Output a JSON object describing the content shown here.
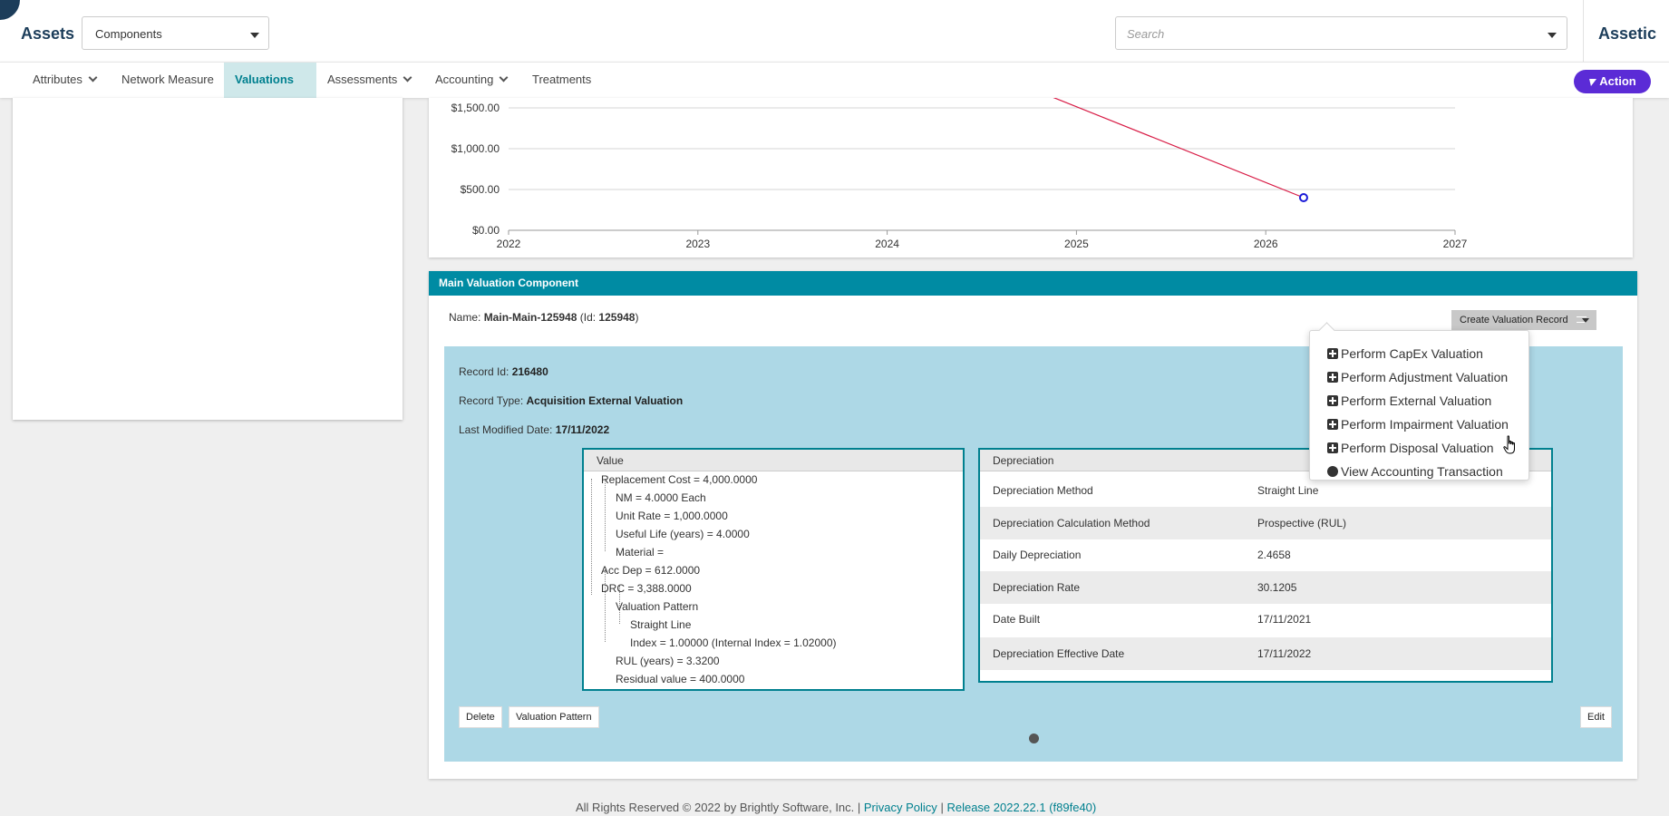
{
  "app": {
    "title": "Assets",
    "brand": "Assetic"
  },
  "module_select": {
    "value": "Components"
  },
  "search": {
    "placeholder": "Search"
  },
  "nav": {
    "items": [
      {
        "label": "Attributes"
      },
      {
        "label": "Network Measure"
      },
      {
        "label": "Valuations"
      },
      {
        "label": "Assessments"
      },
      {
        "label": "Accounting"
      },
      {
        "label": "Treatments"
      }
    ],
    "action_label": "Action"
  },
  "chart_data": {
    "type": "line",
    "x_ticks": [
      "2022",
      "2023",
      "2024",
      "2025",
      "2026",
      "2027"
    ],
    "y_ticks": [
      "$0.00",
      "$500.00",
      "$1,000.00",
      "$1,500.00"
    ],
    "ylim": [
      0,
      1650
    ],
    "xlim": [
      2022,
      2027
    ],
    "series": [
      {
        "x": [
          2024.8,
          2026.2
        ],
        "y": [
          1700,
          400
        ],
        "color": "#d81b45"
      }
    ],
    "highlight_point": {
      "x": 2026.2,
      "y": 400,
      "color": "#1a1ad8"
    }
  },
  "valuation": {
    "header": "Main Valuation Component",
    "name_label": "Name:",
    "name_value": "Main-Main-125948",
    "id_open": "(Id:",
    "id_value": "125948",
    "id_close": ")",
    "create_btn": "Create Valuation Record",
    "record_id_label": "Record Id:",
    "record_id": "216480",
    "record_type_label": "Record Type:",
    "record_type": "Acquisition External Valuation",
    "last_modified_label": "Last Modified Date:",
    "last_modified": "17/11/2022",
    "value_box_title": "Value",
    "tree": [
      "Replacement Cost = 4,000.0000",
      "NM = 4.0000 Each",
      "Unit Rate = 1,000.0000",
      "Useful Life (years) = 4.0000",
      "Material =",
      "Acc Dep = 612.0000",
      "DRC = 3,388.0000",
      "Valuation Pattern",
      "Straight Line",
      "Index = 1.00000 (Internal Index = 1.02000)",
      "RUL (years) = 3.3200",
      "Residual value = 400.0000"
    ],
    "dep_box_title": "Depreciation",
    "depreciation": [
      {
        "k": "Depreciation Method",
        "v": "Straight Line"
      },
      {
        "k": "Depreciation Calculation Method",
        "v": "Prospective (RUL)"
      },
      {
        "k": "Daily Depreciation",
        "v": "2.4658"
      },
      {
        "k": "Depreciation Rate",
        "v": "30.1205"
      },
      {
        "k": "Date Built",
        "v": "17/11/2021"
      },
      {
        "k": "Depreciation Effective Date",
        "v": "17/11/2022"
      }
    ],
    "delete_btn": "Delete",
    "pattern_btn": "Valuation Pattern",
    "edit_btn": "Edit"
  },
  "menu": {
    "items": [
      "Perform CapEx Valuation",
      "Perform Adjustment Valuation",
      "Perform External Valuation",
      "Perform Impairment Valuation",
      "Perform Disposal Valuation",
      "View Accounting Transaction"
    ]
  },
  "footer": {
    "text": "All Rights Reserved © 2022 by Brightly Software, Inc. |",
    "privacy": "Privacy Policy",
    "sep": "|",
    "release": "Release 2022.22.1 (f89fe40)"
  }
}
